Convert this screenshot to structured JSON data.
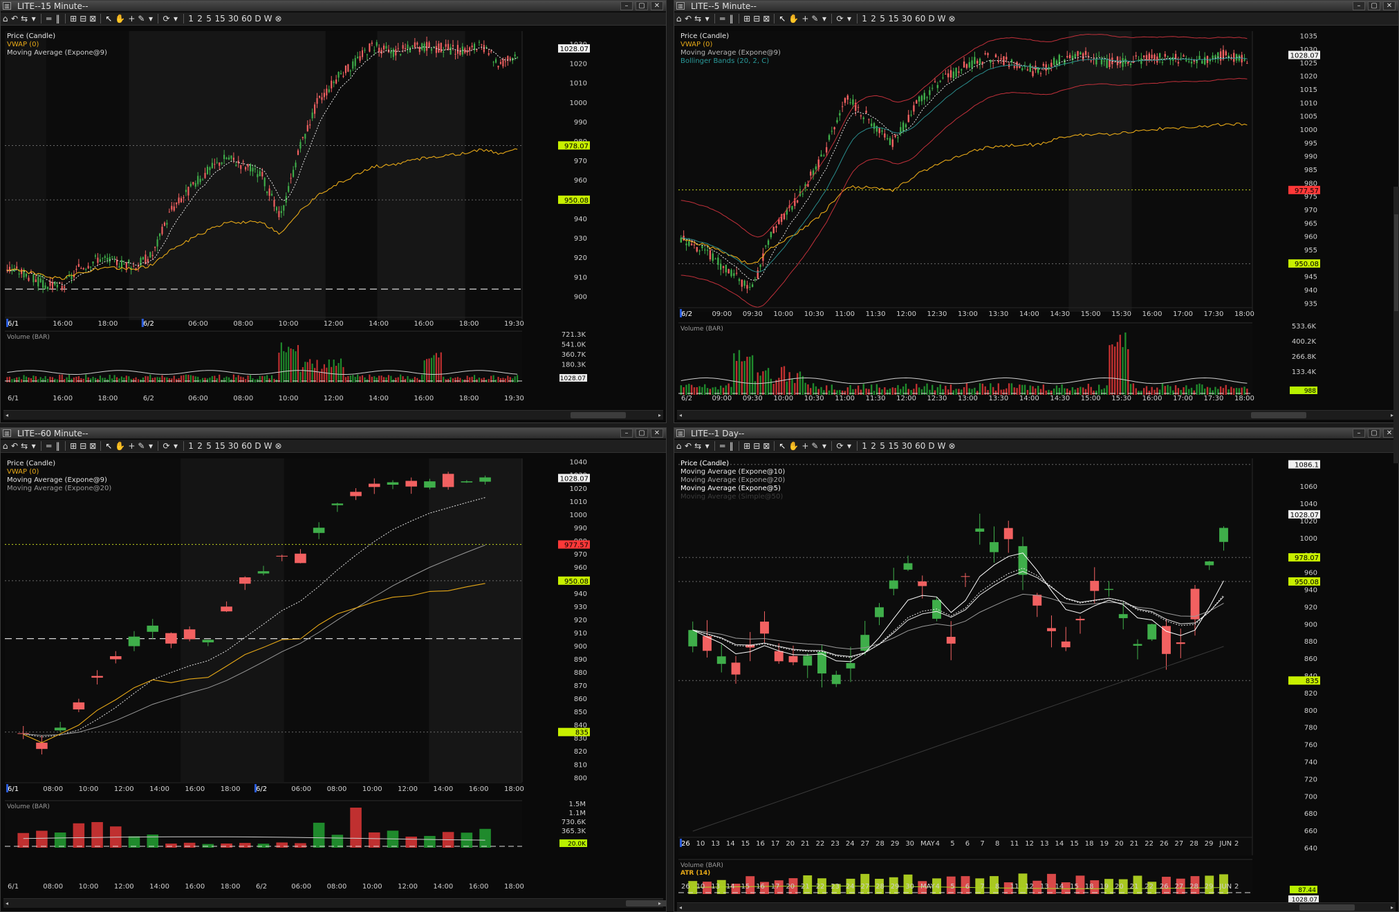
{
  "colors": {
    "up": "#3fae4a",
    "down": "#f26161",
    "vwap": "#e6a817",
    "ema9": "#e8e8e8",
    "ema20": "#9a9a9a",
    "bb_upper": "#c0303a",
    "bb_mid": "#2a8c8c",
    "grid_sep": "#2e2e2e",
    "price_box": "#d8ff40",
    "price_box_red": "#ff4040"
  },
  "toolbar": {
    "items": [
      "⌂",
      "↶",
      "⇆",
      "▾",
      "═",
      "‖",
      "⊞",
      "⊟",
      "⊠",
      "↖",
      "✋",
      "+",
      "✎",
      "▾",
      "⟳",
      "▾",
      "1",
      "2",
      "5",
      "15",
      "30",
      "60",
      "D",
      "W",
      "⊗"
    ]
  },
  "window_buttons": {
    "min": "–",
    "max": "▢",
    "close": "✕"
  },
  "panels": [
    {
      "id": "p15",
      "title": "LITE--15 Minute--",
      "legend": [
        {
          "text": "Price (Candle)",
          "color": "#e8e8e8"
        },
        {
          "text": "VWAP (0)",
          "color": "#e6a817"
        },
        {
          "text": "Moving Average (Expone@9)",
          "color": "#d0d0d0"
        }
      ],
      "ymin": 888,
      "ymax": 1037,
      "yticks": [
        "1030",
        "1020",
        "1010",
        "1000",
        "990",
        "980",
        "970",
        "960",
        "950",
        "940",
        "930",
        "920",
        "910",
        "900"
      ],
      "tags": [
        {
          "text": "1028.07",
          "value": 1028.07,
          "kind": "white"
        },
        {
          "text": "978.07",
          "value": 978.07,
          "kind": "green"
        },
        {
          "text": "950.08",
          "value": 950.08,
          "kind": "green"
        }
      ],
      "hlines": [
        {
          "value": 978,
          "style": "dot"
        },
        {
          "value": 950,
          "style": "dot"
        },
        {
          "value": 904,
          "style": "dash"
        }
      ],
      "xlabels": [
        "6/1",
        "16:00",
        "18:00",
        "6/2",
        "06:00",
        "08:00",
        "10:00",
        "12:00",
        "14:00",
        "16:00",
        "18:00",
        "19:30"
      ],
      "vol_label": "Volume (BAR)",
      "vol_ticks": [
        "721.3K",
        "541.0K",
        "360.7K",
        "180.3K"
      ],
      "vol_tag": "1028.07"
    },
    {
      "id": "p5",
      "title": "LITE--5 Minute--",
      "legend": [
        {
          "text": "Price (Candle)",
          "color": "#e8e8e8"
        },
        {
          "text": "VWAP (0)",
          "color": "#e6a817"
        },
        {
          "text": "Moving Average (Expone@9)",
          "color": "#b5b5b5"
        },
        {
          "text": "Bollinger Bands (20, 2, C)",
          "color": "#2a9a9a"
        }
      ],
      "ymin": 932,
      "ymax": 1037,
      "yticks": [
        "1035",
        "1030",
        "1025",
        "1020",
        "1015",
        "1010",
        "1005",
        "1000",
        "995",
        "990",
        "985",
        "980",
        "975",
        "970",
        "965",
        "960",
        "955",
        "950",
        "945",
        "940",
        "935"
      ],
      "tags": [
        {
          "text": "1028.07",
          "value": 1028.07,
          "kind": "white"
        },
        {
          "text": "977.57",
          "value": 977.57,
          "kind": "red"
        },
        {
          "text": "950.08",
          "value": 950.08,
          "kind": "green"
        }
      ],
      "hlines": [
        {
          "value": 977.6,
          "style": "ydot"
        },
        {
          "value": 950,
          "style": "dot"
        }
      ],
      "xlabels": [
        "6/2",
        "09:00",
        "09:30",
        "10:00",
        "10:30",
        "11:00",
        "11:30",
        "12:00",
        "12:30",
        "13:00",
        "13:30",
        "14:00",
        "14:30",
        "15:00",
        "15:30",
        "16:00",
        "17:00",
        "17:30",
        "18:00"
      ],
      "vol_label": "Volume (BAR)",
      "vol_ticks": [
        "533.6K",
        "400.2K",
        "266.8K",
        "133.4K"
      ],
      "vol_tag": "988"
    },
    {
      "id": "p60",
      "title": "LITE--60 Minute--",
      "legend": [
        {
          "text": "Price (Candle)",
          "color": "#e8e8e8"
        },
        {
          "text": "VWAP (0)",
          "color": "#e6a817"
        },
        {
          "text": "Moving Average (Expone@9)",
          "color": "#e0e0e0"
        },
        {
          "text": "Moving Average (Expone@20)",
          "color": "#9a9a9a"
        }
      ],
      "ymin": 797,
      "ymax": 1043,
      "yticks": [
        "1040",
        "1030",
        "1020",
        "1010",
        "1000",
        "990",
        "980",
        "970",
        "960",
        "950",
        "940",
        "930",
        "920",
        "910",
        "900",
        "890",
        "880",
        "870",
        "860",
        "850",
        "840",
        "830",
        "820",
        "810",
        "800"
      ],
      "tags": [
        {
          "text": "1028.07",
          "value": 1028.07,
          "kind": "white"
        },
        {
          "text": "977.57",
          "value": 977.57,
          "kind": "red"
        },
        {
          "text": "950.08",
          "value": 950.08,
          "kind": "green"
        },
        {
          "text": "835",
          "value": 835,
          "kind": "green"
        }
      ],
      "hlines": [
        {
          "value": 977.6,
          "style": "ydot"
        },
        {
          "value": 950,
          "style": "dot"
        },
        {
          "value": 906,
          "style": "dash"
        },
        {
          "value": 835,
          "style": "dot"
        }
      ],
      "xlabels": [
        "6/1",
        "08:00",
        "10:00",
        "12:00",
        "14:00",
        "16:00",
        "18:00",
        "6/2",
        "06:00",
        "08:00",
        "10:00",
        "12:00",
        "14:00",
        "16:00",
        "18:00"
      ],
      "vol_label": "Volume (BAR)",
      "vol_ticks": [
        "1.5M",
        "1.1M",
        "730.6K",
        "365.3K"
      ],
      "vol_tag": "20.0K"
    },
    {
      "id": "pD",
      "title": "LITE--1 Day--",
      "legend": [
        {
          "text": "Price (Candle)",
          "color": "#ffffff"
        },
        {
          "text": "Moving Average (Expone@10)",
          "color": "#e6e6e6"
        },
        {
          "text": "Moving Average (Expone@20)",
          "color": "#a8a8a8"
        },
        {
          "text": "Moving Average (Expone@5)",
          "color": "#ffffff"
        },
        {
          "text": "Moving Average (Simple@50)",
          "color": "#3c3c3c"
        }
      ],
      "ymin": 632,
      "ymax": 1093,
      "yticks": [
        "1060",
        "1040",
        "1020",
        "1000",
        "980",
        "960",
        "940",
        "920",
        "900",
        "880",
        "860",
        "840",
        "820",
        "800",
        "780",
        "760",
        "740",
        "720",
        "700",
        "680",
        "660",
        "640"
      ],
      "tags": [
        {
          "text": "1086.1",
          "value": 1086.1,
          "kind": "white"
        },
        {
          "text": "1028.07",
          "value": 1028.07,
          "kind": "white"
        },
        {
          "text": "978.07",
          "value": 978.07,
          "kind": "green"
        },
        {
          "text": "950.08",
          "value": 950.08,
          "kind": "green"
        },
        {
          "text": "835",
          "value": 835,
          "kind": "green"
        }
      ],
      "hlines": [
        {
          "value": 1086,
          "style": "dot"
        },
        {
          "value": 978,
          "style": "dot"
        },
        {
          "value": 950,
          "style": "dot"
        },
        {
          "value": 835,
          "style": "dot"
        }
      ],
      "xlabels": [
        "26",
        "10",
        "13",
        "14",
        "15",
        "16",
        "17",
        "20",
        "21",
        "22",
        "23",
        "24",
        "27",
        "28",
        "29",
        "30",
        "MAY",
        "4",
        "5",
        "6",
        "7",
        "8",
        "11",
        "12",
        "13",
        "14",
        "15",
        "18",
        "19",
        "20",
        "21",
        "22",
        "26",
        "27",
        "28",
        "29",
        "JUN",
        "2"
      ],
      "vol_label": "Volume (BAR)",
      "atr_label": "ATR (14)",
      "vol_ticks": [],
      "vol_tag": "87.44",
      "vol_tag2": "1028.07"
    }
  ]
}
